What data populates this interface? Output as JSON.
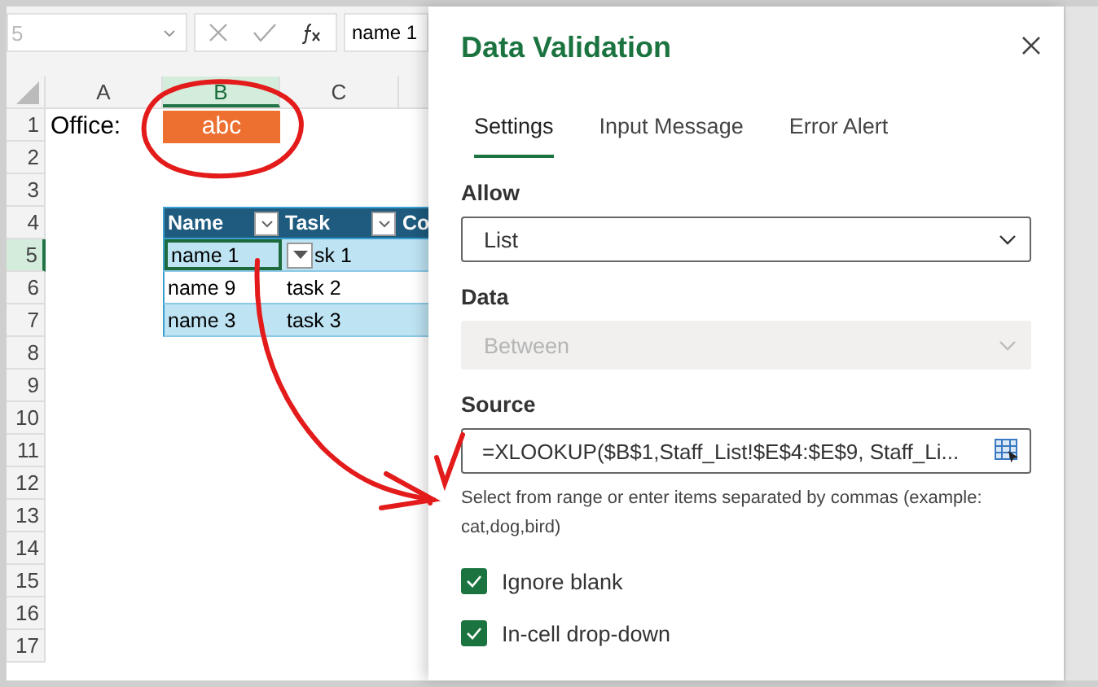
{
  "formula_bar": {
    "name_box": "5",
    "content": "name 1"
  },
  "columns": [
    {
      "label": "A",
      "selected": false
    },
    {
      "label": "B",
      "selected": true
    },
    {
      "label": "C",
      "selected": false
    }
  ],
  "rows": [
    {
      "label": "1",
      "selected": false
    },
    {
      "label": "2",
      "selected": false
    },
    {
      "label": "3",
      "selected": false
    },
    {
      "label": "4",
      "selected": false
    },
    {
      "label": "5",
      "selected": true
    },
    {
      "label": "6",
      "selected": false
    },
    {
      "label": "7",
      "selected": false
    },
    {
      "label": "8",
      "selected": false
    },
    {
      "label": "9",
      "selected": false
    },
    {
      "label": "10",
      "selected": false
    },
    {
      "label": "11",
      "selected": false
    },
    {
      "label": "12",
      "selected": false
    },
    {
      "label": "13",
      "selected": false
    },
    {
      "label": "14",
      "selected": false
    },
    {
      "label": "15",
      "selected": false
    },
    {
      "label": "16",
      "selected": false
    },
    {
      "label": "17",
      "selected": false
    }
  ],
  "office_label": "Office:",
  "office_value": "abc",
  "table": {
    "columns": [
      "Name",
      "Task",
      "Co"
    ],
    "rows": [
      {
        "name": "name 1",
        "task": "sk 1",
        "selected": true
      },
      {
        "name": "name 9",
        "task": "task 2",
        "selected": false
      },
      {
        "name": "name 3",
        "task": "task 3",
        "selected": false
      }
    ]
  },
  "dialog": {
    "title": "Data Validation",
    "tabs": [
      {
        "label": "Settings",
        "selected": true
      },
      {
        "label": "Input Message",
        "selected": false
      },
      {
        "label": "Error Alert",
        "selected": false
      }
    ],
    "fields": [
      {
        "kind": "select",
        "label": "Allow",
        "value": "List",
        "disabled": false
      },
      {
        "kind": "select",
        "label": "Data",
        "value": "Between",
        "disabled": true
      },
      {
        "kind": "range",
        "label": "Source",
        "value": "=XLOOKUP($B$1,Staff_List!$E$4:$E$9, Staff_Li...",
        "help": "Select from range or enter items separated by commas (example: cat,dog,bird)",
        "disabled": false
      }
    ],
    "checkboxes": [
      {
        "label": "Ignore blank",
        "checked": true
      },
      {
        "label": "In-cell drop-down",
        "checked": true
      }
    ]
  }
}
